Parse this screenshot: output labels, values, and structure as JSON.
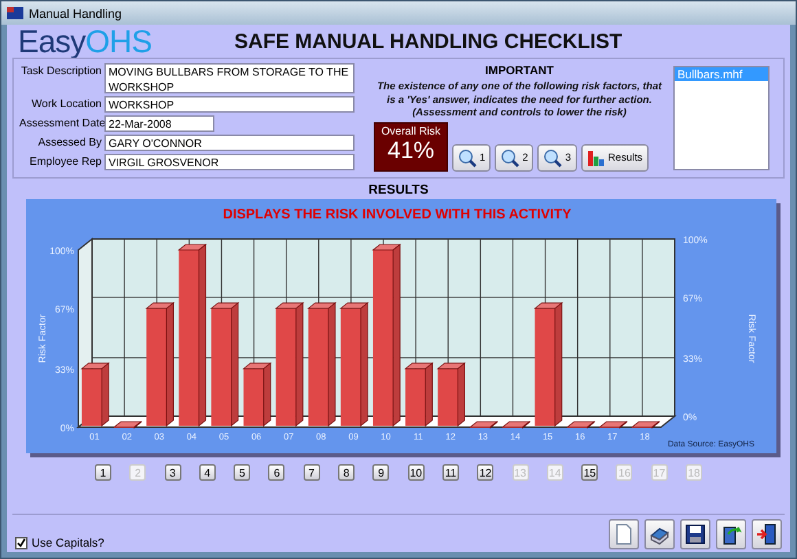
{
  "window": {
    "title": "Manual Handling"
  },
  "logo": {
    "part1": "Easy",
    "part2": "OHS"
  },
  "heading": "SAFE MANUAL HANDLING CHECKLIST",
  "form": [
    {
      "label": "Task Description",
      "value": "MOVING BULLBARS FROM STORAGE TO THE WORKSHOP",
      "kind": "multiline"
    },
    {
      "label": "Work Location",
      "value": "WORKSHOP",
      "kind": "text"
    },
    {
      "label": "Assessment Date",
      "value": "22-Mar-2008",
      "kind": "date"
    },
    {
      "label": "Assessed By",
      "value": "GARY O'CONNOR",
      "kind": "text"
    },
    {
      "label": "Employee Rep",
      "value": "VIRGIL GROSVENOR",
      "kind": "text"
    }
  ],
  "important": {
    "title": "IMPORTANT",
    "text": "The existence of any one of the following risk factors, that is a 'Yes' answer, indicates the need for further action. (Assessment and controls to lower the risk)"
  },
  "overall_risk": {
    "label": "Overall Risk",
    "value": "41%"
  },
  "toolbar": [
    {
      "label": "1",
      "kind": "zoom"
    },
    {
      "label": "2",
      "kind": "zoom"
    },
    {
      "label": "3",
      "kind": "zoom"
    },
    {
      "label": "Results",
      "kind": "results"
    }
  ],
  "files": [
    {
      "name": "Bullbars.mhf",
      "selected": true
    }
  ],
  "results": {
    "title": "RESULTS",
    "source": "Data Source: EasyOHS",
    "chart_data": {
      "type": "bar",
      "title": "DISPLAYS THE RISK INVOLVED WITH THIS ACTIVITY",
      "ylabel": "Risk Factor",
      "categories": [
        "01",
        "02",
        "03",
        "04",
        "05",
        "06",
        "07",
        "08",
        "09",
        "10",
        "11",
        "12",
        "13",
        "14",
        "15",
        "16",
        "17",
        "18"
      ],
      "series": [
        {
          "color": "#e04848",
          "values": [
            33,
            0,
            67,
            100,
            67,
            33,
            67,
            67,
            67,
            100,
            33,
            33,
            0,
            0,
            67,
            0,
            0,
            0
          ]
        }
      ],
      "grid": true,
      "annotations": [
        {
          "text": "Risk Factor"
        }
      ],
      "ylim": [
        0,
        100
      ],
      "yticks": [
        {
          "value": 0,
          "label": "0%"
        },
        {
          "value": 33,
          "label": "33%"
        },
        {
          "value": 67,
          "label": "67%"
        },
        {
          "value": 100,
          "label": "100%"
        }
      ]
    }
  },
  "factor_buttons": [
    {
      "label": "1",
      "disabled": false
    },
    {
      "label": "2",
      "disabled": true
    },
    {
      "label": "3",
      "disabled": false
    },
    {
      "label": "4",
      "disabled": false
    },
    {
      "label": "5",
      "disabled": false
    },
    {
      "label": "6",
      "disabled": false
    },
    {
      "label": "7",
      "disabled": false
    },
    {
      "label": "8",
      "disabled": false
    },
    {
      "label": "9",
      "disabled": false
    },
    {
      "label": "10",
      "disabled": false
    },
    {
      "label": "11",
      "disabled": false
    },
    {
      "label": "12",
      "disabled": false
    },
    {
      "label": "13",
      "disabled": true
    },
    {
      "label": "14",
      "disabled": true
    },
    {
      "label": "15",
      "disabled": false
    },
    {
      "label": "16",
      "disabled": true
    },
    {
      "label": "17",
      "disabled": true
    },
    {
      "label": "18",
      "disabled": true
    }
  ],
  "use_capitals": {
    "label": "Use Capitals?",
    "checked": true
  },
  "actions": [
    {
      "kind": "new"
    },
    {
      "kind": "print"
    },
    {
      "kind": "save"
    },
    {
      "kind": "open"
    },
    {
      "kind": "exit"
    }
  ]
}
